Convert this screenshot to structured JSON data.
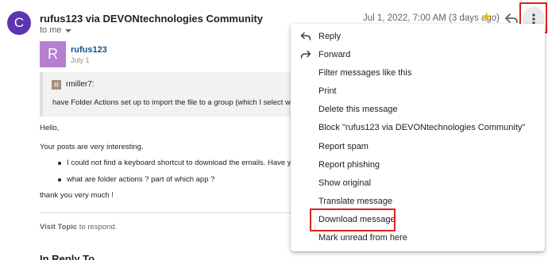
{
  "header": {
    "avatar_letter": "C",
    "sender": "rufus123 via DEVONtechnologies Community",
    "to": "to me",
    "date": "Jul 1, 2022, 7:00 AM (3 days ago)"
  },
  "post": {
    "avatar_letter": "R",
    "username": "rufus123",
    "date": "July 1"
  },
  "quote": {
    "avatar_letter": "R",
    "username": "rmiller7:",
    "text": "have Folder Actions set up to import the file to a group (which I select wit"
  },
  "body": {
    "greeting": "Hello,",
    "line1": "Your posts are very interesting.",
    "bullets": [
      "I could not find a keyboard shortcut to download the emails. Have yo",
      "what are folder actions ? part of which app ?"
    ],
    "closing": "thank you very much !"
  },
  "footer": {
    "visit_link": "Visit Topic",
    "visit_rest": " to respond.",
    "in_reply_to": "In Reply To"
  },
  "menu": {
    "items": [
      {
        "label": "Reply",
        "icon": "reply-icon"
      },
      {
        "label": "Forward",
        "icon": "forward-icon"
      },
      {
        "label": "Filter messages like this"
      },
      {
        "label": "Print"
      },
      {
        "label": "Delete this message"
      },
      {
        "label": "Block \"rufus123 via DEVONtechnologies Community\""
      },
      {
        "label": "Report spam"
      },
      {
        "label": "Report phishing"
      },
      {
        "label": "Show original"
      },
      {
        "label": "Translate message"
      },
      {
        "label": "Download message"
      },
      {
        "label": "Mark unread from here"
      }
    ]
  },
  "colors": {
    "avatar_main": "#5e35b1",
    "avatar_post": "#b77fd0",
    "highlight_box": "#e02020",
    "star": "#f4b400"
  },
  "icons": [
    "star-icon",
    "reply-icon",
    "more-vert-icon",
    "forward-icon",
    "chevron-down-icon"
  ]
}
